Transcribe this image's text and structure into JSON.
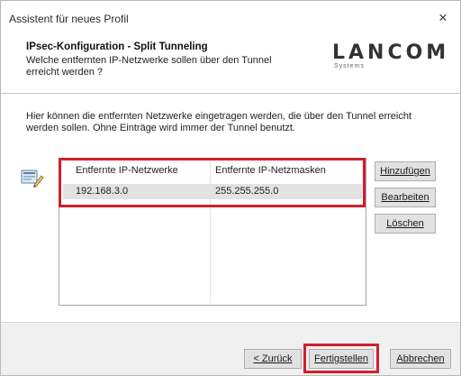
{
  "window": {
    "title": "Assistent für neues Profil",
    "close_glyph": "×"
  },
  "header": {
    "title": "IPsec-Konfiguration - Split Tunneling",
    "subtitle": "Welche entfernten IP-Netzwerke sollen über den Tunnel erreicht werden ?",
    "logo_main": "LANCOM",
    "logo_sub": "Systems"
  },
  "body": {
    "description": "Hier können die entfernten Netzwerke eingetragen werden, die über den Tunnel erreicht werden sollen. Ohne Einträge wird immer der Tunnel benutzt.",
    "icon": "network-edit-icon"
  },
  "table": {
    "columns": [
      "Entfernte IP-Netzwerke",
      "Entfernte IP-Netzmasken"
    ],
    "rows": [
      {
        "network": "192.168.3.0",
        "mask": "255.255.255.0"
      }
    ]
  },
  "side_buttons": {
    "add": "Hinzufügen",
    "edit": "Bearbeiten",
    "delete": "Löschen"
  },
  "footer_buttons": {
    "back": "< Zurück",
    "finish": "Fertigstellen",
    "cancel": "Abbrechen"
  },
  "colors": {
    "highlight": "#d0202d",
    "row_bg": "#e2e2e2",
    "footer_bg": "#f0f0f0"
  }
}
